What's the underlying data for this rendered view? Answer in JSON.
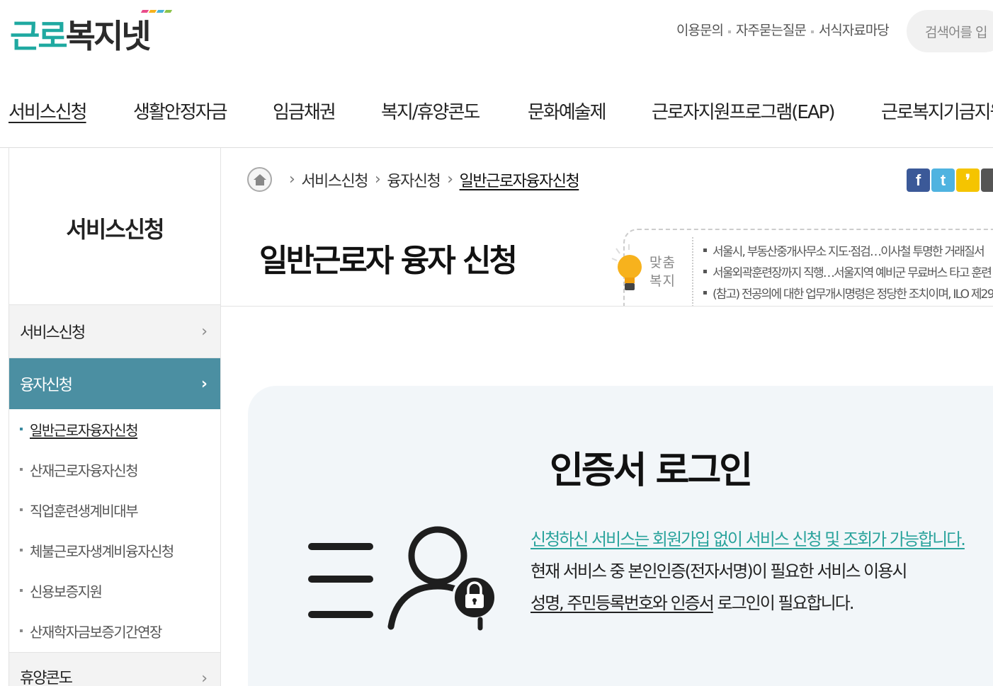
{
  "header": {
    "logo": {
      "part1": "근로",
      "part2": "복지넷"
    },
    "util_links": [
      "이용문의",
      "자주묻는질문",
      "서식자료마당"
    ],
    "search_placeholder": "검색어를 입"
  },
  "gnb": {
    "items": [
      "서비스신청",
      "생활안정자금",
      "임금채권",
      "복지/휴양콘도",
      "문화예술제",
      "근로자지원프로그램(EAP)",
      "근로복지기금지원"
    ],
    "active": "서비스신청"
  },
  "lnb": {
    "title": "서비스신청",
    "sections": [
      {
        "label": "서비스신청"
      },
      {
        "label": "융자신청"
      }
    ],
    "sub_items": [
      "일반근로자융자신청",
      "산재근로자융자신청",
      "직업훈련생계비대부",
      "체불근로자생계비융자신청",
      "신용보증지원",
      "산재학자금보증기간연장"
    ],
    "active_sub": "일반근로자융자신청",
    "last": {
      "label": "휴양콘도"
    }
  },
  "breadcrumb": {
    "items": [
      "서비스신청",
      "융자신청"
    ],
    "current": "일반근로자융자신청"
  },
  "sns": [
    "facebook-icon",
    "twitter-icon",
    "kakaostory-icon",
    "blog-icon"
  ],
  "page_title": "일반근로자 융자 신청",
  "custom_welfare": {
    "label_top": "맞춤",
    "label_bottom": "복지",
    "news": [
      "서울시, 부동산중개사무소 지도·점검…이사철 투명한 거래질서",
      "서울외곽훈련장까지 직행…서울지역 예비군 무료버스 타고 훈련",
      "(참고) 전공의에 대한 업무개시명령은 정당한 조치이며, ILO 제29"
    ]
  },
  "cert": {
    "title": "인증서 로그인",
    "line1": "신청하신 서비스는 회원가입 없이 서비스 신청 및 조회가 가능합니다.",
    "line2": "현재 서비스 중 본인인증(전자서명)이 필요한 서비스 이용시",
    "line3_u": "성명, 주민등록번호와 인증서",
    "line3_rest": " 로그인이 필요합니다."
  },
  "colors": {
    "brand_teal": "#1fa9a1",
    "lnb_active": "#4b8fa2",
    "panel_bg": "#f2f6f9"
  }
}
